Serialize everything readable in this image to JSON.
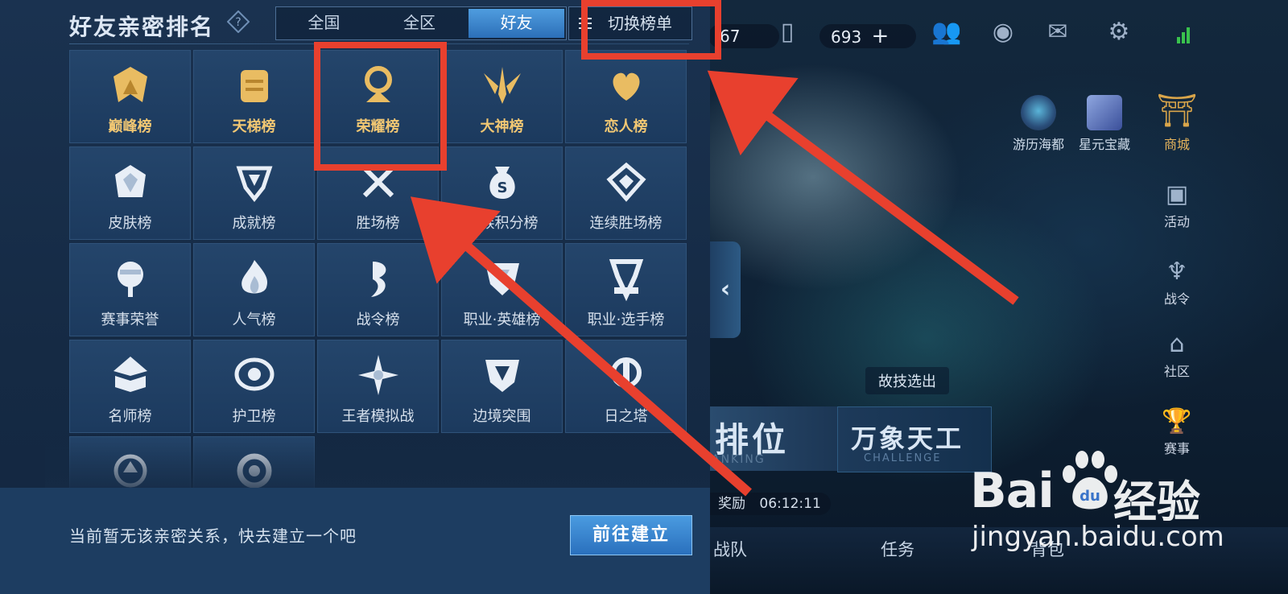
{
  "panel": {
    "title": "好友亲密排名",
    "tabs": [
      {
        "label": "全国",
        "active": false
      },
      {
        "label": "全区",
        "active": false
      },
      {
        "label": "好友",
        "active": true
      }
    ],
    "switch_label": "切换榜单",
    "rankings": [
      {
        "label": "巅峰榜",
        "icon": "peak-icon",
        "gold": true
      },
      {
        "label": "天梯榜",
        "icon": "ladder-icon",
        "gold": true
      },
      {
        "label": "荣耀榜",
        "icon": "glory-icon",
        "gold": true
      },
      {
        "label": "大神榜",
        "icon": "master-icon",
        "gold": true
      },
      {
        "label": "恋人榜",
        "icon": "lovers-icon",
        "gold": true
      },
      {
        "label": "皮肤榜",
        "icon": "skin-icon",
        "gold": false
      },
      {
        "label": "成就榜",
        "icon": "achievement-icon",
        "gold": false
      },
      {
        "label": "胜场榜",
        "icon": "swords-icon",
        "gold": false
      },
      {
        "label": "贵族积分榜",
        "icon": "money-bag-icon",
        "gold": false
      },
      {
        "label": "连续胜场榜",
        "icon": "streak-icon",
        "gold": false
      },
      {
        "label": "赛事荣誉",
        "icon": "tournament-icon",
        "gold": false
      },
      {
        "label": "人气榜",
        "icon": "flame-icon",
        "gold": false
      },
      {
        "label": "战令榜",
        "icon": "battle-pass-icon",
        "gold": false
      },
      {
        "label": "职业·英雄榜",
        "icon": "pro-hero-icon",
        "gold": false
      },
      {
        "label": "职业·选手榜",
        "icon": "pro-player-icon",
        "gold": false
      },
      {
        "label": "名师榜",
        "icon": "mentor-icon",
        "gold": false
      },
      {
        "label": "护卫榜",
        "icon": "guardian-icon",
        "gold": false
      },
      {
        "label": "王者模拟战",
        "icon": "auto-chess-icon",
        "gold": false
      },
      {
        "label": "边境突围",
        "icon": "breakout-icon",
        "gold": false
      },
      {
        "label": "日之塔",
        "icon": "sun-tower-icon",
        "gold": false
      },
      {
        "label": "",
        "icon": "emblem-icon",
        "gold": false
      },
      {
        "label": "",
        "icon": "ring-icon",
        "gold": false
      }
    ],
    "footer_text": "当前暂无该亲密关系，快去建立一个吧",
    "go_button": "前往建立"
  },
  "game": {
    "currency1": "67",
    "currency2": "693",
    "side_buttons": [
      {
        "label": "商城",
        "icon": "shop-icon"
      },
      {
        "label": "活动",
        "icon": "activity-icon"
      },
      {
        "label": "战令",
        "icon": "battle-pass-icon"
      },
      {
        "label": "社区",
        "icon": "community-icon"
      },
      {
        "label": "赛事",
        "icon": "trophy-icon"
      }
    ],
    "mid_buttons": [
      {
        "label": "游历海都",
        "icon": "travel-icon"
      },
      {
        "label": "星元宝藏",
        "icon": "treasure-icon"
      }
    ],
    "skill_tag": "故技选出",
    "rank_big": "排位",
    "rank_sub": "ANKING",
    "challenge_big": "万象天工",
    "challenge_sub": "CHALLENGE",
    "timer_label": "奖励",
    "timer_value": "06:12:11",
    "bottom_items": [
      "战队",
      "任务",
      "背包"
    ]
  },
  "watermark": {
    "brand": "Bai",
    "brand2": "经验",
    "url": "jingyan.baidu.com"
  },
  "colors": {
    "accent": "#e8402e",
    "gold": "#f1c773",
    "tab_active": "#2c6fb8"
  }
}
